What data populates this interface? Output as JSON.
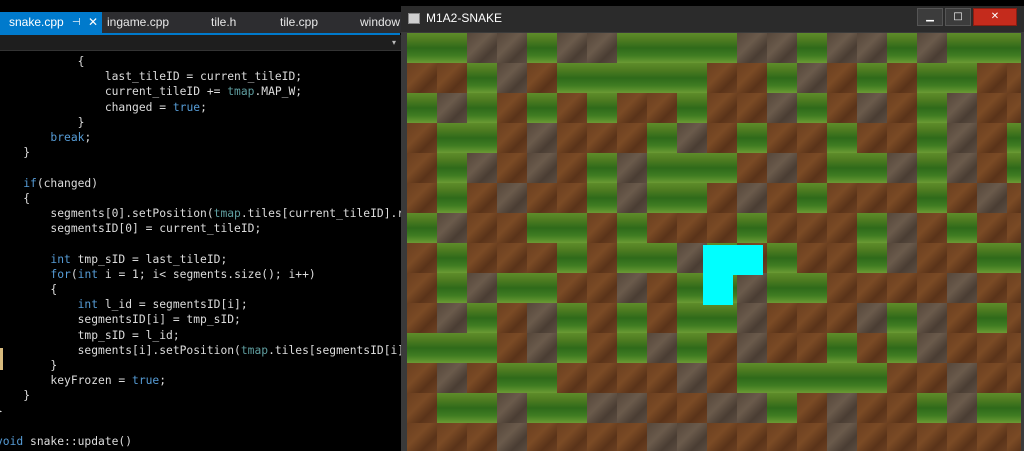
{
  "editor": {
    "tabs": [
      {
        "label": "snake.cpp",
        "active": true
      },
      {
        "label": "ingame.cpp",
        "active": false
      },
      {
        "label": "tile.h",
        "active": false
      },
      {
        "label": "tile.cpp",
        "active": false
      },
      {
        "label": "window",
        "active": false
      }
    ],
    "pin_glyph": "⊣",
    "close_glyph": "✕",
    "nav_dropdown_glyph": "▾",
    "lines": [
      {
        "segs": [
          {
            "t": "            {"
          }
        ]
      },
      {
        "segs": [
          {
            "t": "                last_tileID = current_tileID;"
          }
        ]
      },
      {
        "segs": [
          {
            "t": "                current_tileID += "
          },
          {
            "t": "tmap",
            "c": "nm"
          },
          {
            "t": ".MAP_W;"
          }
        ]
      },
      {
        "segs": [
          {
            "t": "                changed = "
          },
          {
            "t": "true",
            "c": "kw"
          },
          {
            "t": ";"
          }
        ]
      },
      {
        "segs": [
          {
            "t": "            }"
          }
        ]
      },
      {
        "segs": [
          {
            "t": "        "
          },
          {
            "t": "break",
            "c": "kw"
          },
          {
            "t": ";"
          }
        ]
      },
      {
        "segs": [
          {
            "t": "    }"
          }
        ]
      },
      {
        "segs": [
          {
            "t": ""
          }
        ]
      },
      {
        "segs": [
          {
            "t": "    "
          },
          {
            "t": "if",
            "c": "kw"
          },
          {
            "t": "(changed)"
          }
        ]
      },
      {
        "segs": [
          {
            "t": "    {"
          }
        ]
      },
      {
        "segs": [
          {
            "t": "        segments[0].setPosition("
          },
          {
            "t": "tmap",
            "c": "nm"
          },
          {
            "t": ".tiles[current_tileID].re"
          }
        ]
      },
      {
        "segs": [
          {
            "t": "        segmentsID[0] = current_tileID;"
          }
        ]
      },
      {
        "segs": [
          {
            "t": ""
          }
        ]
      },
      {
        "segs": [
          {
            "t": "        "
          },
          {
            "t": "int",
            "c": "kw"
          },
          {
            "t": " tmp_sID = last_tileID;"
          }
        ]
      },
      {
        "segs": [
          {
            "t": "        "
          },
          {
            "t": "for",
            "c": "kw"
          },
          {
            "t": "("
          },
          {
            "t": "int",
            "c": "kw"
          },
          {
            "t": " i = 1; i< segments.size(); i++)"
          }
        ]
      },
      {
        "segs": [
          {
            "t": "        {"
          }
        ]
      },
      {
        "segs": [
          {
            "t": "            "
          },
          {
            "t": "int",
            "c": "kw"
          },
          {
            "t": " l_id = segmentsID[i];"
          }
        ]
      },
      {
        "segs": [
          {
            "t": "            segmentsID[i] = tmp_sID;"
          }
        ]
      },
      {
        "segs": [
          {
            "t": "            tmp_sID = l_id;"
          }
        ]
      },
      {
        "segs": [
          {
            "t": "            segments[i].setPosition("
          },
          {
            "t": "tmap",
            "c": "nm"
          },
          {
            "t": ".tiles[segmentsID[i]]"
          }
        ]
      },
      {
        "segs": [
          {
            "t": "        }"
          }
        ]
      },
      {
        "segs": [
          {
            "t": "        keyFrozen = "
          },
          {
            "t": "true",
            "c": "kw"
          },
          {
            "t": ";"
          }
        ]
      },
      {
        "segs": [
          {
            "t": "    }"
          }
        ]
      },
      {
        "segs": [
          {
            "t": "}"
          }
        ]
      },
      {
        "segs": [
          {
            "t": ""
          }
        ]
      },
      {
        "segs": [
          {
            "t": "void",
            "c": "kw"
          },
          {
            "t": " snake::update()"
          }
        ]
      }
    ]
  },
  "game": {
    "title": "M1A2-SNAKE",
    "minimize_glyph": "▁",
    "maximize_glyph": "□",
    "close_glyph": "✕",
    "grid_rows": [
      "GGSSGSSGGGGSSGSSGSGGG",
      "DDGSDGGGGGDDGSDGDGGDD",
      "GSGDGDGDDGDDSGDSDGSDD",
      "DGGDSDDDGSDGDDGDDGSDG",
      "DGSDSDGSGGGDSDGGSGSDG",
      "DGDSDDGSGGDSDGDDDGDSD",
      "GSDDGGDGDDDGDDDGSDGDD",
      "DGDDDGDGGSGDGDDGSDDGG",
      "DGSGGDDSDGGSGGDDDDSDD",
      "DSGDSGDGDGGSDDDSGSDGD",
      "GGGDSGDGSGDSDDGDGSDDD",
      "DSDGGDDDDSDGGGGGDDSDD",
      "DGGSGGSSDDSSGDSDDGSGG",
      "DDDSDDDDSSDDDDSDDDDDD"
    ],
    "snake_color": "#00ffff"
  }
}
